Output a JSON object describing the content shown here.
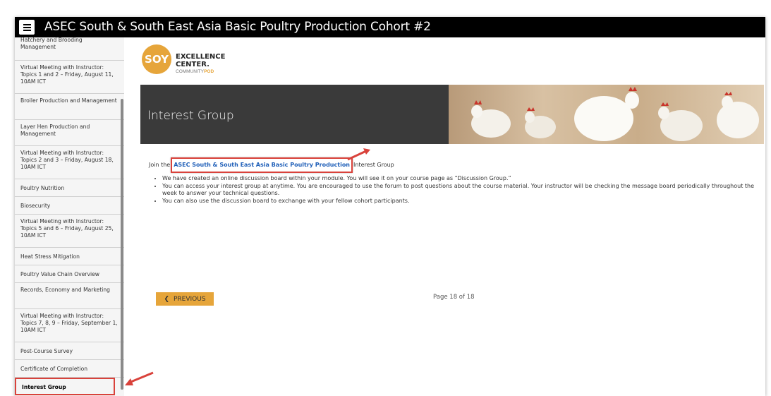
{
  "header": {
    "title": "ASEC South & South East Asia Basic Poultry Production Cohort #2",
    "menu_icon": "hamburger-menu-icon"
  },
  "sidebar": {
    "items": [
      {
        "label": "Hatchery and Brooding Management",
        "active": false
      },
      {
        "label": "Virtual Meeting with Instructor: Topics 1 and 2 – Friday, August 11, 10AM ICT",
        "active": false
      },
      {
        "label": "Broiler Production and Management",
        "active": false
      },
      {
        "label": "Layer Hen Production and Management",
        "active": false
      },
      {
        "label": "Virtual Meeting with Instructor: Topics 2 and 3 – Friday, August 18, 10AM ICT",
        "active": false
      },
      {
        "label": "Poultry Nutrition",
        "active": false
      },
      {
        "label": "Biosecurity",
        "active": false
      },
      {
        "label": "Virtual Meeting with Instructor: Topics 5 and 6 – Friday, August 25, 10AM ICT",
        "active": false
      },
      {
        "label": "Heat Stress Mitigation",
        "active": false
      },
      {
        "label": "Poultry Value Chain Overview",
        "active": false
      },
      {
        "label": "Records, Economy and Marketing",
        "active": false
      },
      {
        "label": "Virtual Meeting with Instructor: Topics 7, 8, 9 – Friday, September 1, 10AM ICT",
        "active": false
      },
      {
        "label": "Post-Course Survey",
        "active": false
      },
      {
        "label": "Certificate of Completion",
        "active": false
      },
      {
        "label": "Interest Group",
        "active": true
      }
    ]
  },
  "logo": {
    "circle": "SOY",
    "line1": "EXCELLENCE",
    "line2": "CENTER.",
    "line3a": "COMMUNITY",
    "line3b": "POD"
  },
  "banner": {
    "title": "Interest Group"
  },
  "content": {
    "join_prefix": "Join the",
    "join_link": "ASEC South & South East Asia Basic Poultry Production",
    "join_suffix": "Interest Group",
    "bullets": [
      "We have created an online discussion board within your module. You will see it on your course page as “Discussion Group.”",
      "You can access your interest group at anytime. You are encouraged to use the forum to post questions about the course material. Your instructor will be checking the message board periodically throughout the week to answer your technical questions.",
      "You can also use the discussion board to exchange with your fellow cohort participants."
    ]
  },
  "footer": {
    "prev_label": "PREVIOUS",
    "page_label": "Page 18 of 18"
  },
  "colors": {
    "accent": "#e6a53a",
    "highlight": "#d9423b",
    "link": "#1f5fb8",
    "topbar": "#000000",
    "banner": "#3a3a3a"
  }
}
